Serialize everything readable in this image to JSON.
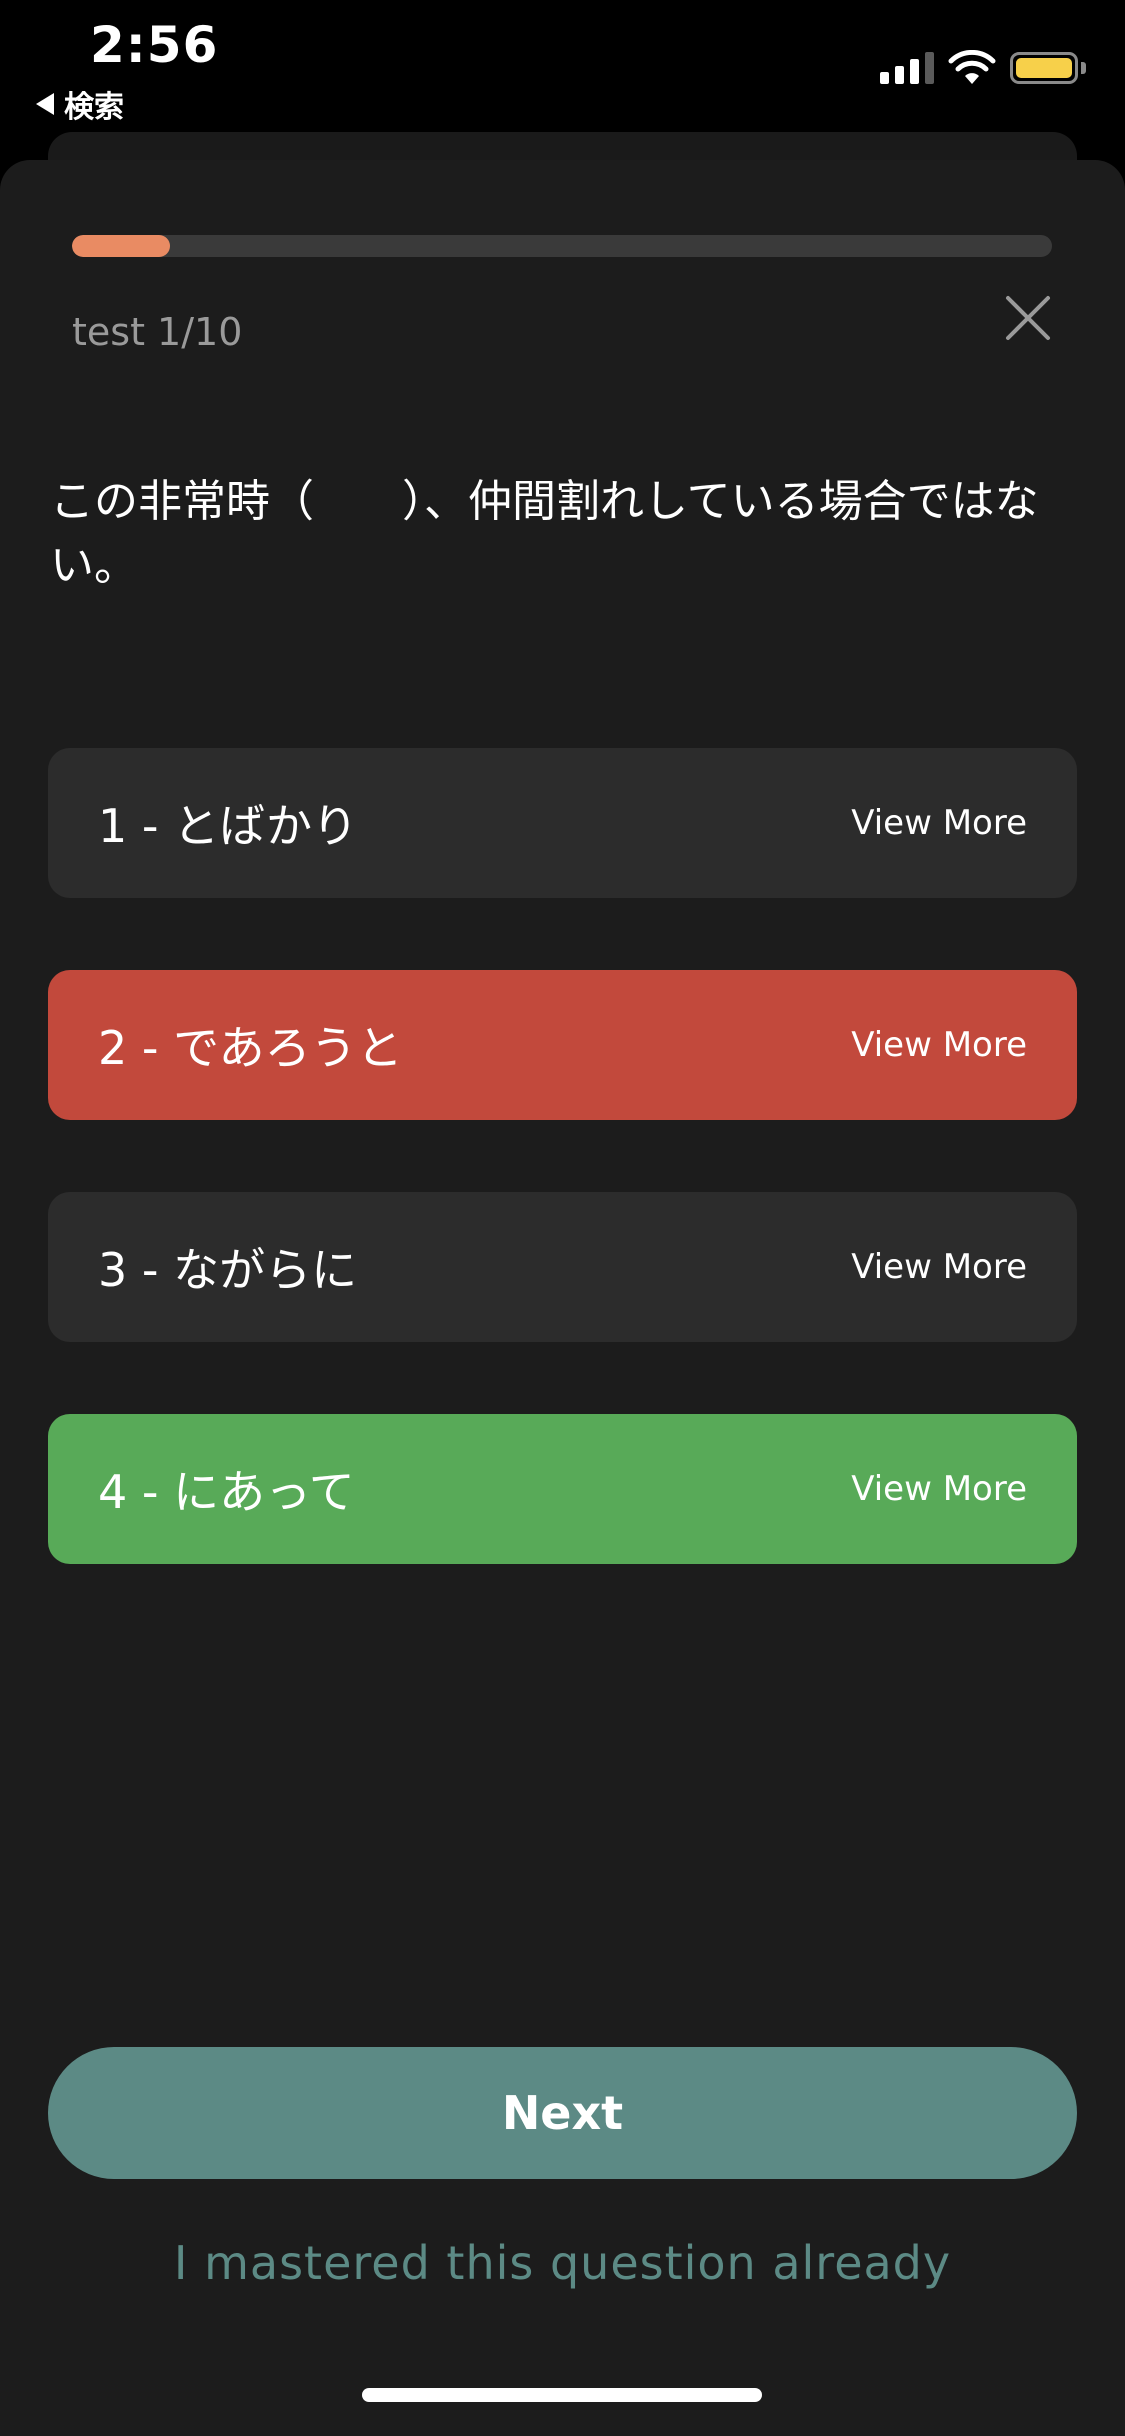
{
  "status_bar": {
    "time": "2:56",
    "back_label": "検索",
    "battery_color": "#f7d04a"
  },
  "quiz": {
    "progress_label": "test 1/10",
    "progress_fraction": 0.1,
    "progress_color": "#e98b63",
    "question": "この非常時（　　）、仲間割れしている場合ではない。",
    "options": [
      {
        "label": "1 - とばかり",
        "action": "View More",
        "state": "default"
      },
      {
        "label": "2 - であろうと",
        "action": "View More",
        "state": "wrong"
      },
      {
        "label": "3 - ながらに",
        "action": "View More",
        "state": "default"
      },
      {
        "label": "4 - にあって",
        "action": "View More",
        "state": "correct"
      }
    ],
    "next_label": "Next",
    "mastered_label": "I mastered this question already"
  },
  "colors": {
    "wrong": "#c2493c",
    "correct": "#58aa58",
    "accent": "#5c8a85",
    "option_default": "#2c2c2c"
  }
}
